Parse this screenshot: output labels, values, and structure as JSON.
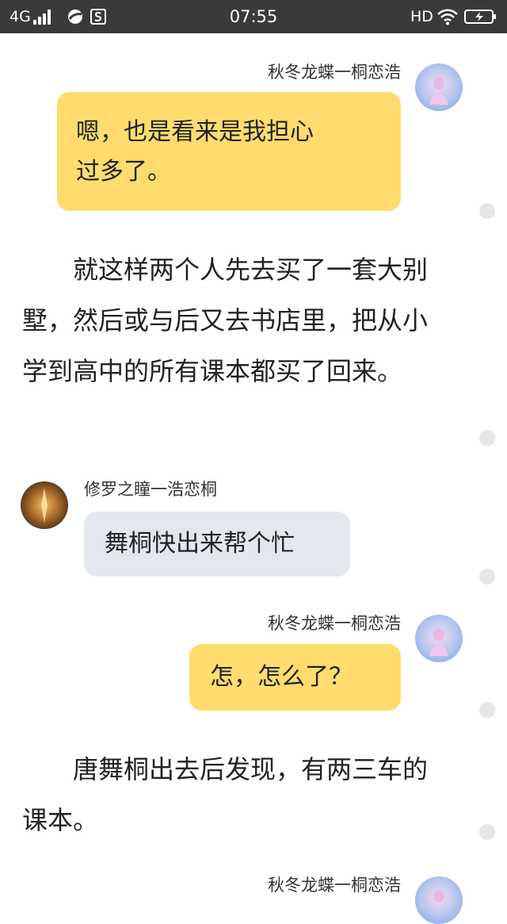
{
  "status_bar": {
    "network": "4G",
    "time": "07:55",
    "hd": "HD",
    "icons": [
      "signal-icon",
      "browser-icon",
      "s-app-icon",
      "wifi-icon",
      "battery-charging-icon"
    ]
  },
  "colors": {
    "status_bar_bg": "#3a3a3a",
    "bubble_right": "#ffdc6d",
    "bubble_left": "#e3e8ef",
    "text": "#222222"
  },
  "messages": [
    {
      "speaker": "秋冬龙蝶一桐恋浩",
      "lines": [
        "嗯，也是看来是我担心",
        "过多了。"
      ]
    },
    {
      "text": "就这样两个人先去买了一套大别墅，然后或与后又去书店里，把从小学到高中的所有课本都买了回来。"
    },
    {
      "speaker": "修罗之瞳一浩恋桐",
      "lines": [
        "舞桐快出来帮个忙"
      ]
    },
    {
      "speaker": "秋冬龙蝶一桐恋浩",
      "lines": [
        "怎，怎么了？"
      ]
    },
    {
      "text": "唐舞桐出去后发现，有两三车的课本。"
    },
    {
      "speaker": "秋冬龙蝶一桐恋浩"
    }
  ]
}
